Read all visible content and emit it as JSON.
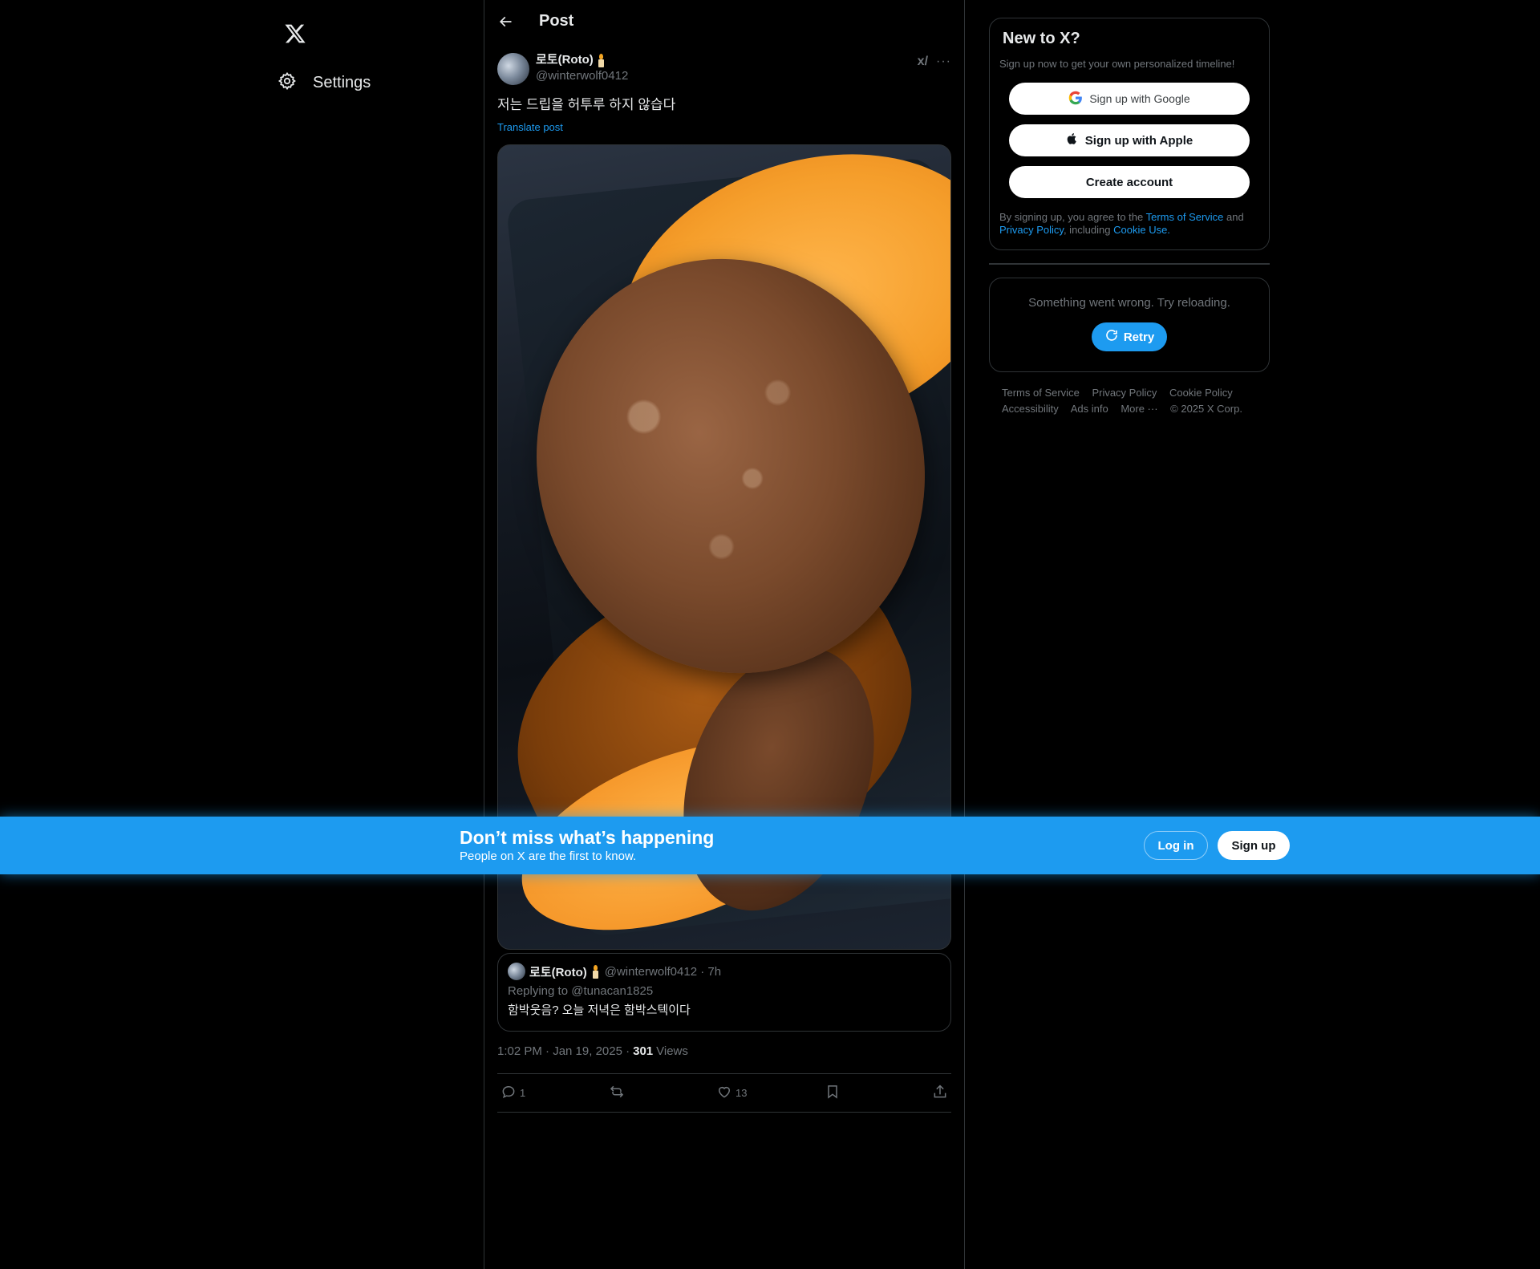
{
  "nav": {
    "settings_label": "Settings"
  },
  "header": {
    "title": "Post"
  },
  "post": {
    "display_name": "로토(Roto)",
    "handle": "@winterwolf0412",
    "text": "저는 드립을 허투루 하지 않습다",
    "translate": "Translate post",
    "grok_label": "x/",
    "more_label": "···",
    "time": "1:02 PM · Jan 19, 2025 ·",
    "views_count": "301",
    "views_label": "Views"
  },
  "quote": {
    "display_name": "로토(Roto)",
    "meta": "@winterwolf0412 · 7h",
    "replying": "Replying to @tunacan1825",
    "text": "함박웃음? 오늘 저녁은 함박스텍이다"
  },
  "actions": {
    "replies": "1",
    "reposts": "",
    "likes": "13"
  },
  "signup_card": {
    "title": "New to X?",
    "subtitle": "Sign up now to get your own personalized timeline!",
    "google": "Sign up with Google",
    "apple": "Sign up with Apple",
    "create": "Create account",
    "legal_1": "By signing up, you agree to the ",
    "legal_tos": "Terms of Service",
    "legal_2": " and ",
    "legal_privacy": "Privacy Policy",
    "legal_3": ", including ",
    "legal_cookie": "Cookie Use."
  },
  "error_card": {
    "message": "Something went wrong. Try reloading.",
    "retry": "Retry"
  },
  "footer": {
    "links": [
      "Terms of Service",
      "Privacy Policy",
      "Cookie Policy",
      "Accessibility",
      "Ads info",
      "More ···",
      "© 2025 X Corp."
    ]
  },
  "banner": {
    "title": "Don’t miss what’s happening",
    "subtitle": "People on X are the first to know.",
    "login": "Log in",
    "signup": "Sign up"
  },
  "colors": {
    "accent": "#1d9bf0",
    "background": "#000000",
    "border": "#2f3336",
    "muted": "#71767b"
  }
}
